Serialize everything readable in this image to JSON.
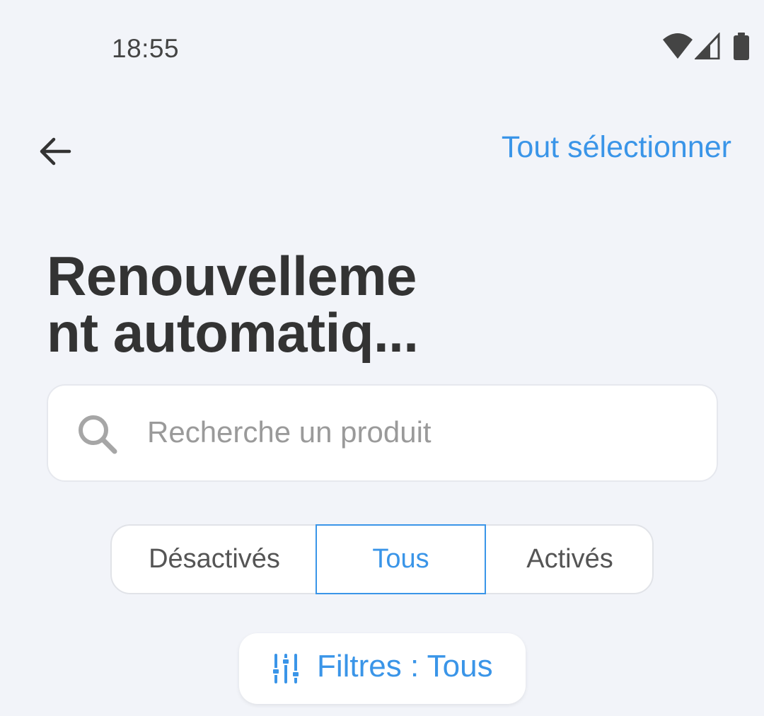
{
  "status_bar": {
    "time": "18:55",
    "icons": [
      "wifi-icon",
      "signal-icon",
      "battery-icon"
    ]
  },
  "app_bar": {
    "back_icon": "arrow-left-icon",
    "select_all_label": "Tout sélectionner"
  },
  "page": {
    "title": "Renouvelleme nt automatiq..."
  },
  "search": {
    "icon": "search-icon",
    "placeholder": "Recherche un produit",
    "value": ""
  },
  "segments": {
    "items": [
      {
        "label": "Désactivés",
        "selected": false
      },
      {
        "label": "Tous",
        "selected": true
      },
      {
        "label": "Activés",
        "selected": false
      }
    ]
  },
  "filter": {
    "icon": "sliders-icon",
    "label": "Filtres : Tous"
  },
  "colors": {
    "background": "#f2f4f9",
    "accent": "#3a95e8",
    "text_dark": "#333333",
    "placeholder": "#9a9a9a"
  }
}
